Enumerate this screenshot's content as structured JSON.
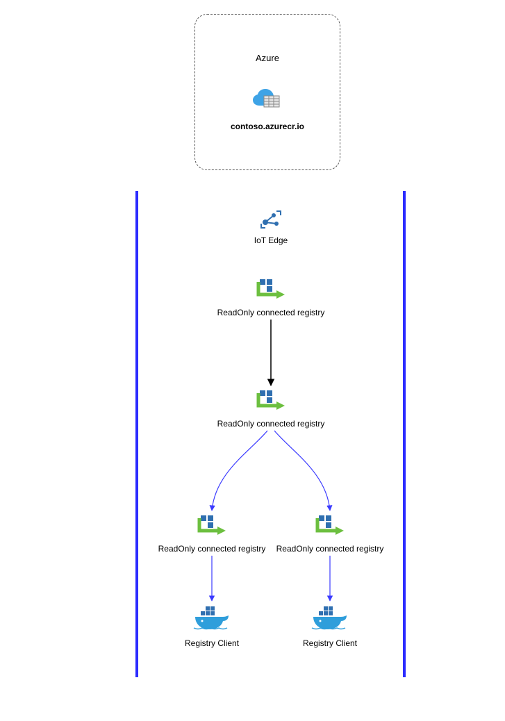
{
  "azure": {
    "title": "Azure",
    "registry_label": "contoso.azurecr.io"
  },
  "nodes": {
    "iot_edge": "IoT Edge",
    "readonly_1": "ReadOnly connected registry",
    "readonly_2": "ReadOnly connected registry",
    "readonly_left": "ReadOnly connected registry",
    "readonly_right": "ReadOnly connected registry",
    "client_left": "Registry Client",
    "client_right": "Registry Client"
  },
  "icons": {
    "cloud_acr": "cloud-acr-icon",
    "iot_edge": "iot-edge-icon",
    "registry_arrow": "registry-arrow-icon",
    "docker": "docker-whale-icon"
  },
  "colors": {
    "border_blue": "#2b2bff",
    "arrow_black": "#000000",
    "arrow_blue": "#3a3aff",
    "azure_blue": "#3ea3e6",
    "square_blue": "#2f6fb0",
    "arrow_green": "#6cbf3f"
  }
}
